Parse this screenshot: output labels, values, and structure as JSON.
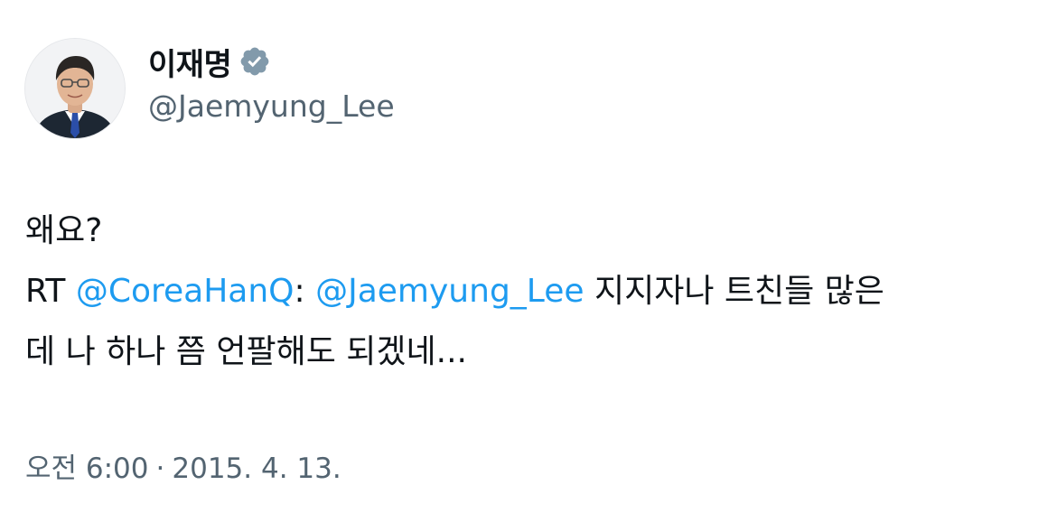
{
  "author": {
    "display_name": "이재명",
    "handle": "@Jaemyung_Lee",
    "verified_icon": "verified-badge-icon",
    "avatar_icon": "profile-photo"
  },
  "tweet": {
    "first_line": "왜요?",
    "rt_prefix": "RT",
    "rt_mention": "@CoreaHanQ",
    "colon": ":",
    "mention_target": "@Jaemyung_Lee",
    "text_after_mention": " 지지자나 트친들 많은",
    "second_line": "데 나 하나 쯤 언팔해도 되겠네...",
    "time": "오전 6:00",
    "separator": "·",
    "date": "2015. 4. 13."
  },
  "colors": {
    "text": "#0f1419",
    "secondary": "#536471",
    "link": "#1d9bf0",
    "verified": "#829aab"
  }
}
